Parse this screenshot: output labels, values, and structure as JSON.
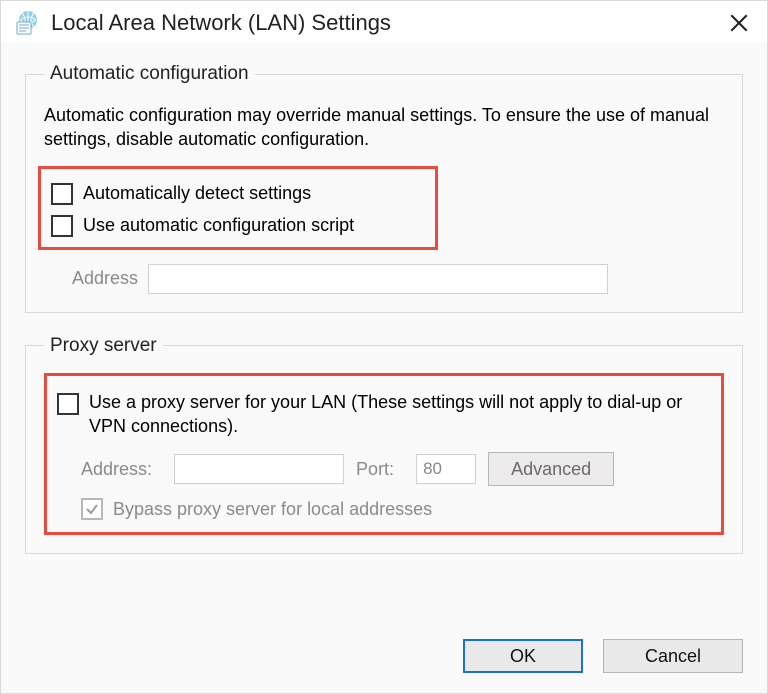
{
  "title": "Local Area Network (LAN) Settings",
  "group_auto": {
    "legend": "Automatic configuration",
    "description": "Automatic configuration may override manual settings.  To ensure the use of manual settings, disable automatic configuration.",
    "detect_label": "Automatically detect settings",
    "script_label": "Use automatic configuration script",
    "address_label": "Address",
    "address_value": ""
  },
  "group_proxy": {
    "legend": "Proxy server",
    "use_proxy_label": "Use a proxy server for your LAN (These settings will not apply to dial-up or VPN connections).",
    "address_label": "Address:",
    "address_value": "",
    "port_label": "Port:",
    "port_value": "80",
    "advanced_label": "Advanced",
    "bypass_label": "Bypass proxy server for local addresses"
  },
  "buttons": {
    "ok": "OK",
    "cancel": "Cancel"
  }
}
